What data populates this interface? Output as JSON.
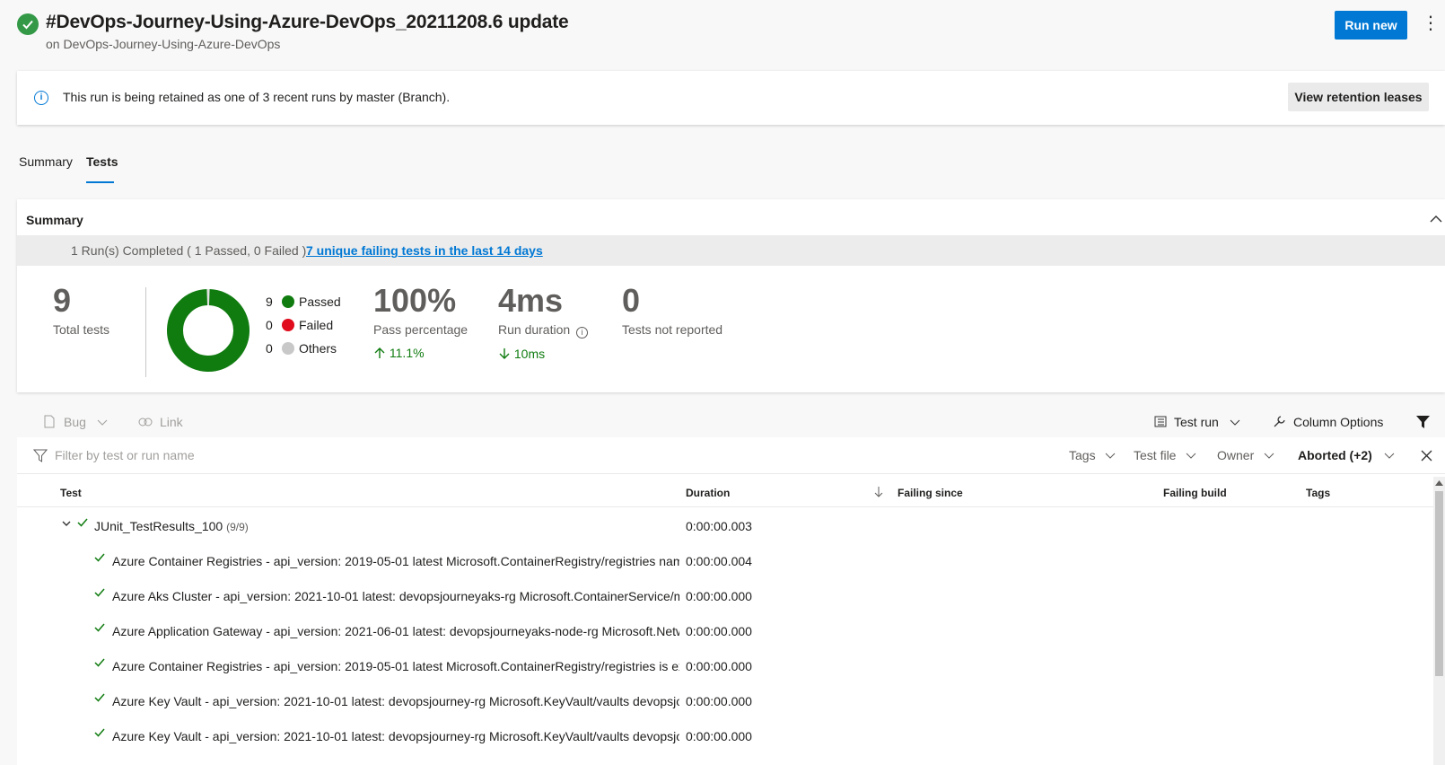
{
  "header": {
    "title": "#DevOps-Journey-Using-Azure-DevOps_20211208.6 update",
    "subtitle": "on DevOps-Journey-Using-Azure-DevOps",
    "run_new_label": "Run new",
    "more_label": "⋮",
    "status_color": "#339947"
  },
  "banner": {
    "message": "This run is being retained as one of 3 recent runs by master (Branch).",
    "button_label": "View retention leases",
    "info_glyph": "i"
  },
  "tabs": [
    {
      "label": "Summary",
      "active": false
    },
    {
      "label": "Tests",
      "active": true
    }
  ],
  "summary": {
    "title": "Summary",
    "run_text": "1 Run(s) Completed ( 1 Passed, 0 Failed )",
    "failing_link": "7 unique failing tests in the last 14 days",
    "total_tests": "9",
    "total_label": "Total tests",
    "legend": [
      {
        "count": "9",
        "label": "Passed",
        "color": "#107c10"
      },
      {
        "count": "0",
        "label": "Failed",
        "color": "#e00b1c"
      },
      {
        "count": "0",
        "label": "Others",
        "color": "#c8c8c8"
      }
    ],
    "donut_passed_fraction": 1.0,
    "pass_percentage": "100%",
    "pass_label": "Pass percentage",
    "pass_trend": "11.1%",
    "duration": "4ms",
    "duration_label": "Run duration",
    "duration_trend": "10ms",
    "not_reported": "0",
    "not_reported_label": "Tests not reported"
  },
  "toolbar": {
    "bug_label": "Bug",
    "link_label": "Link",
    "test_run_label": "Test run",
    "column_options_label": "Column Options"
  },
  "filters": {
    "placeholder": "Filter by test or run name",
    "tags": "Tags",
    "test_file": "Test file",
    "owner": "Owner",
    "outcome": "Aborted (+2)"
  },
  "columns": {
    "test": "Test",
    "duration": "Duration",
    "failing_since": "Failing since",
    "failing_build": "Failing build",
    "tags": "Tags"
  },
  "group": {
    "name": "JUnit_TestResults_100",
    "count": "(9/9)",
    "duration": "0:00:00.003"
  },
  "rows": [
    {
      "name": "Azure Container Registries - api_version: 2019-05-01 latest Microsoft.ContainerRegistry/registries names",
      "duration": "0:00:00.004"
    },
    {
      "name": "Azure Aks Cluster - api_version: 2021-10-01 latest: devopsjourneyaks-rg Microsoft.ContainerService/mar",
      "duration": "0:00:00.000"
    },
    {
      "name": "Azure Application Gateway - api_version: 2021-06-01 latest: devopsjourneyaks-node-rg Microsoft.Netwo",
      "duration": "0:00:00.000"
    },
    {
      "name": "Azure Container Registries - api_version: 2019-05-01 latest Microsoft.ContainerRegistry/registries is expe",
      "duration": "0:00:00.000"
    },
    {
      "name": "Azure Key Vault - api_version: 2021-10-01 latest: devopsjourney-rg Microsoft.KeyVault/vaults devopsjou",
      "duration": "0:00:00.000"
    },
    {
      "name": "Azure Key Vault - api_version: 2021-10-01 latest: devopsjourney-rg Microsoft.KeyVault/vaults devopsjou",
      "duration": "0:00:00.000"
    }
  ]
}
